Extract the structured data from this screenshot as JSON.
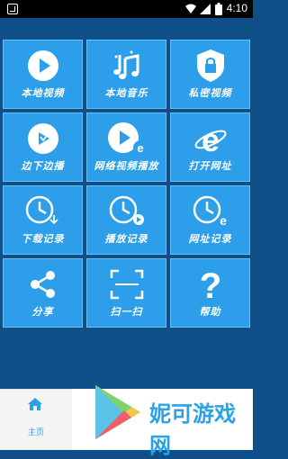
{
  "status_bar": {
    "time": "4:10"
  },
  "tiles": [
    {
      "label": "本地视频",
      "icon": "play-circle-icon"
    },
    {
      "label": "本地音乐",
      "icon": "music-notes-icon"
    },
    {
      "label": "私密视频",
      "icon": "shield-lock-icon"
    },
    {
      "label": "边下边播",
      "icon": "play-download-icon"
    },
    {
      "label": "网络视频播放",
      "icon": "play-ie-icon"
    },
    {
      "label": "打开网址",
      "icon": "ie-browser-icon"
    },
    {
      "label": "下载记录",
      "icon": "clock-download-icon"
    },
    {
      "label": "播放记录",
      "icon": "clock-play-icon"
    },
    {
      "label": "网址记录",
      "icon": "clock-ie-icon"
    },
    {
      "label": "分享",
      "icon": "share-icon"
    },
    {
      "label": "扫一扫",
      "icon": "scan-icon"
    },
    {
      "label": "帮助",
      "icon": "question-icon"
    }
  ],
  "bottom_nav": {
    "home_label": "主页",
    "home_icon": "home-icon"
  },
  "watermark": {
    "text": "妮可游戏网",
    "icon": "play-store-icon"
  },
  "colors": {
    "tile": "#2d9ee9",
    "background": "#0e5087",
    "accent": "#2aa3e6"
  }
}
